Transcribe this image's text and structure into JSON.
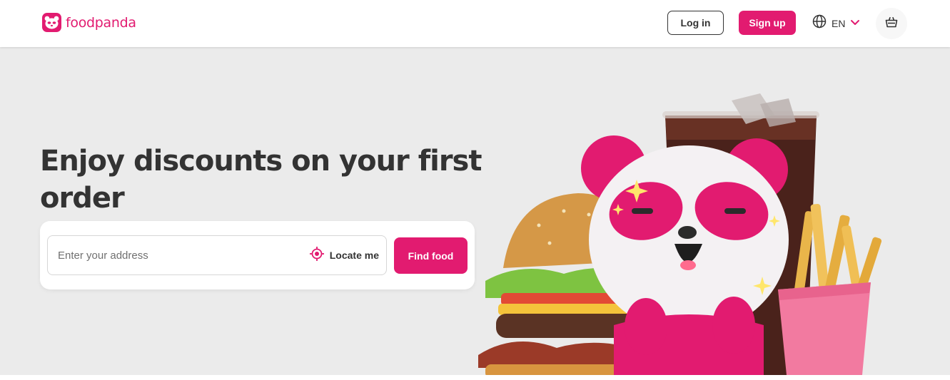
{
  "brand": {
    "name": "foodpanda",
    "color": "#e21b70",
    "icon": "panda-logo-icon"
  },
  "header": {
    "login_label": "Log in",
    "signup_label": "Sign up",
    "language": "EN",
    "language_icon": "globe-icon",
    "language_chevron": "chevron-down-icon",
    "cart_icon": "shopping-basket-icon"
  },
  "hero": {
    "title": "Enjoy discounts on your first order",
    "background": "#ebebeb",
    "search": {
      "placeholder": "Enter your address",
      "value": "",
      "locate_label": "Locate me",
      "locate_icon": "crosshair-location-icon",
      "submit_label": "Find food"
    },
    "illustration": "panda-mascot-with-burger-fries-and-cola"
  }
}
